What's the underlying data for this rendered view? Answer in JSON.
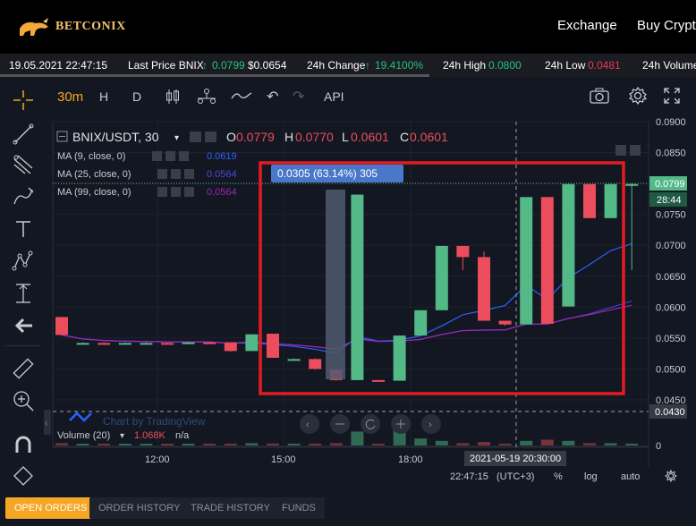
{
  "app": {
    "brand": "BETCONIX",
    "nav": [
      "Exchange",
      "Buy Crypto"
    ]
  },
  "ticker": {
    "datetime": "19.05.2021 22:47:15",
    "last_price_label": "Last Price BNIX",
    "last_price_arrow": "↑",
    "last_price": "0.0799",
    "last_price_usd": "$0.0654",
    "change_label": "24h Change",
    "change_arrow": "↑",
    "change_value": "19.4100%",
    "high_label": "24h High",
    "high_value": "0.0800",
    "low_label": "24h Low",
    "low_value": "0.0481",
    "volume_label": "24h Volume"
  },
  "toolbar": {
    "interval": "30m",
    "hour": "H",
    "day": "D",
    "api": "API"
  },
  "chart": {
    "symbol": "BNIX/USDT, 30",
    "ohlc": {
      "o_label": "O",
      "o": "0.0779",
      "h_label": "H",
      "h": "0.0770",
      "l_label": "L",
      "l": "0.0601",
      "c_label": "C",
      "c": "0.0601"
    },
    "indicators": [
      {
        "label": "MA (9, close, 0)",
        "value": "0.0619",
        "color": "#2962ff"
      },
      {
        "label": "MA (25, close, 0)",
        "value": "0.0564",
        "color": "#3f3fc8"
      },
      {
        "label": "MA (99, close, 0)",
        "value": "0.0564",
        "color": "#9c27b0"
      }
    ],
    "volume": {
      "label": "Volume (20)",
      "value": "1.068K",
      "na": "n/a"
    },
    "watermark": "Chart by TradingView",
    "measure_label": "0.0305 (63.14%) 305",
    "last_price_tag": "0.0799",
    "countdown_tag": "28:44",
    "crosshair_price": "0.0430",
    "crosshair_time": "2021-05-19 20:30:00",
    "clock": "22:47:15",
    "timezone": "(UTC+3)",
    "percent_btn": "%",
    "log_btn": "log",
    "auto_btn": "auto",
    "colors": {
      "up": "#53b987",
      "down": "#eb4d5c",
      "highlight": "#e31b23",
      "measure": "#4a77c9"
    }
  },
  "chart_data": {
    "type": "candlestick",
    "x_ticks": [
      "12:00",
      "15:00",
      "18:00"
    ],
    "y_ticks": [
      "0.0900",
      "0.0850",
      "0.0800",
      "0.0750",
      "0.0700",
      "0.0650",
      "0.0600",
      "0.0550",
      "0.0500",
      "0.0450",
      "0"
    ],
    "ylim": [
      0.0425,
      0.09
    ],
    "candles": [
      {
        "o": 0.0584,
        "c": 0.0555,
        "h": 0.0584,
        "l": 0.0554
      },
      {
        "o": 0.0542,
        "c": 0.0542,
        "h": 0.0543,
        "l": 0.0541
      },
      {
        "o": 0.0542,
        "c": 0.0541,
        "h": 0.0543,
        "l": 0.0541
      },
      {
        "o": 0.0541,
        "c": 0.0542,
        "h": 0.0543,
        "l": 0.0541
      },
      {
        "o": 0.0542,
        "c": 0.0542,
        "h": 0.0543,
        "l": 0.0541
      },
      {
        "o": 0.0542,
        "c": 0.0541,
        "h": 0.0543,
        "l": 0.0541
      },
      {
        "o": 0.0541,
        "c": 0.0543,
        "h": 0.0544,
        "l": 0.0541
      },
      {
        "o": 0.0543,
        "c": 0.0542,
        "h": 0.0544,
        "l": 0.0541
      },
      {
        "o": 0.0543,
        "c": 0.0529,
        "h": 0.0543,
        "l": 0.0528
      },
      {
        "o": 0.0529,
        "c": 0.0556,
        "h": 0.0556,
        "l": 0.0529
      },
      {
        "o": 0.0557,
        "c": 0.0518,
        "h": 0.0557,
        "l": 0.0518
      },
      {
        "o": 0.0516,
        "c": 0.0516,
        "h": 0.0517,
        "l": 0.0515
      },
      {
        "o": 0.0516,
        "c": 0.05,
        "h": 0.0517,
        "l": 0.0499
      },
      {
        "o": 0.0499,
        "c": 0.0482,
        "h": 0.0499,
        "l": 0.0481
      },
      {
        "o": 0.0482,
        "c": 0.0782,
        "h": 0.0782,
        "l": 0.0482,
        "highlight": true
      },
      {
        "o": 0.0482,
        "c": 0.0481,
        "h": 0.0482,
        "l": 0.048
      },
      {
        "o": 0.0481,
        "c": 0.0554,
        "h": 0.0554,
        "l": 0.0481
      },
      {
        "o": 0.0554,
        "c": 0.0595,
        "h": 0.0595,
        "l": 0.0554
      },
      {
        "o": 0.0595,
        "c": 0.0699,
        "h": 0.0699,
        "l": 0.0595
      },
      {
        "o": 0.0699,
        "c": 0.0681,
        "h": 0.0699,
        "l": 0.066
      },
      {
        "o": 0.0681,
        "c": 0.0578,
        "h": 0.069,
        "l": 0.0578
      },
      {
        "o": 0.0578,
        "c": 0.0572,
        "h": 0.0578,
        "l": 0.057
      },
      {
        "o": 0.0572,
        "c": 0.0778,
        "h": 0.0778,
        "l": 0.0572
      },
      {
        "o": 0.0778,
        "c": 0.0573,
        "h": 0.0778,
        "l": 0.0573
      },
      {
        "o": 0.0601,
        "c": 0.0799,
        "h": 0.0799,
        "l": 0.0601
      },
      {
        "o": 0.0799,
        "c": 0.0744,
        "h": 0.0799,
        "l": 0.0744
      },
      {
        "o": 0.0744,
        "c": 0.0799,
        "h": 0.0799,
        "l": 0.0744
      },
      {
        "o": 0.0799,
        "c": 0.0799,
        "h": 0.08,
        "l": 0.066
      }
    ],
    "volumes": [
      0.1,
      0.05,
      0.05,
      0.05,
      0.05,
      0.05,
      0.05,
      0.05,
      0.08,
      0.1,
      0.08,
      0.05,
      0.08,
      0.1,
      0.6,
      0.05,
      1.0,
      0.3,
      0.2,
      0.1,
      0.15,
      0.08,
      0.2,
      0.25,
      0.2,
      0.1,
      0.1,
      0.05
    ]
  },
  "bottom_tabs": [
    "OPEN ORDERS",
    "ORDER HISTORY",
    "TRADE HISTORY",
    "FUNDS"
  ]
}
